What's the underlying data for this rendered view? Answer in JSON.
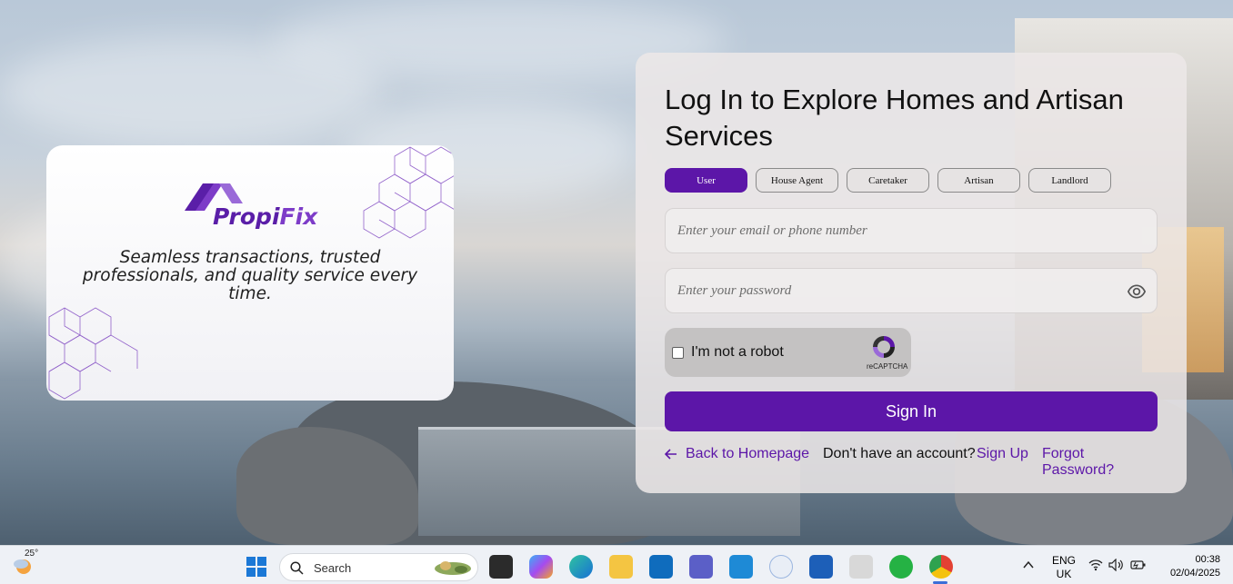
{
  "brand": {
    "name_part1": "Propi",
    "name_part2": "Fix",
    "tagline": "Seamless transactions, trusted professionals, and quality service every time."
  },
  "login": {
    "title": "Log In to Explore Homes and Artisan Services",
    "roles": [
      {
        "label": "User",
        "active": true
      },
      {
        "label": "House Agent",
        "active": false
      },
      {
        "label": "Caretaker",
        "active": false
      },
      {
        "label": "Artisan",
        "active": false
      },
      {
        "label": "Landlord",
        "active": false
      }
    ],
    "email_placeholder": "Enter your email or phone number",
    "password_placeholder": "Enter your password",
    "captcha_label": "I'm not a robot",
    "captcha_brand": "reCAPTCHA",
    "signin_label": "Sign In",
    "back_link": "Back to Homepage",
    "no_account_text": "Don't have an account?",
    "signup_link": "Sign Up",
    "forgot_link": "Forgot Password?"
  },
  "taskbar": {
    "weather_temp": "25°",
    "search_label": "Search",
    "lang_line1": "ENG",
    "lang_line2": "UK",
    "time": "00:38",
    "date": "02/04/2025",
    "apps": [
      "file-explorer-icon",
      "copilot-icon",
      "edge-icon",
      "folder-icon",
      "outlook-icon",
      "teams-icon",
      "vscode-icon",
      "app-store-icon",
      "store-icon",
      "snipping-tool-icon",
      "whatsapp-icon",
      "chrome-icon"
    ]
  },
  "colors": {
    "accent": "#5c16a8",
    "brand_text": "#5a1ea8"
  }
}
